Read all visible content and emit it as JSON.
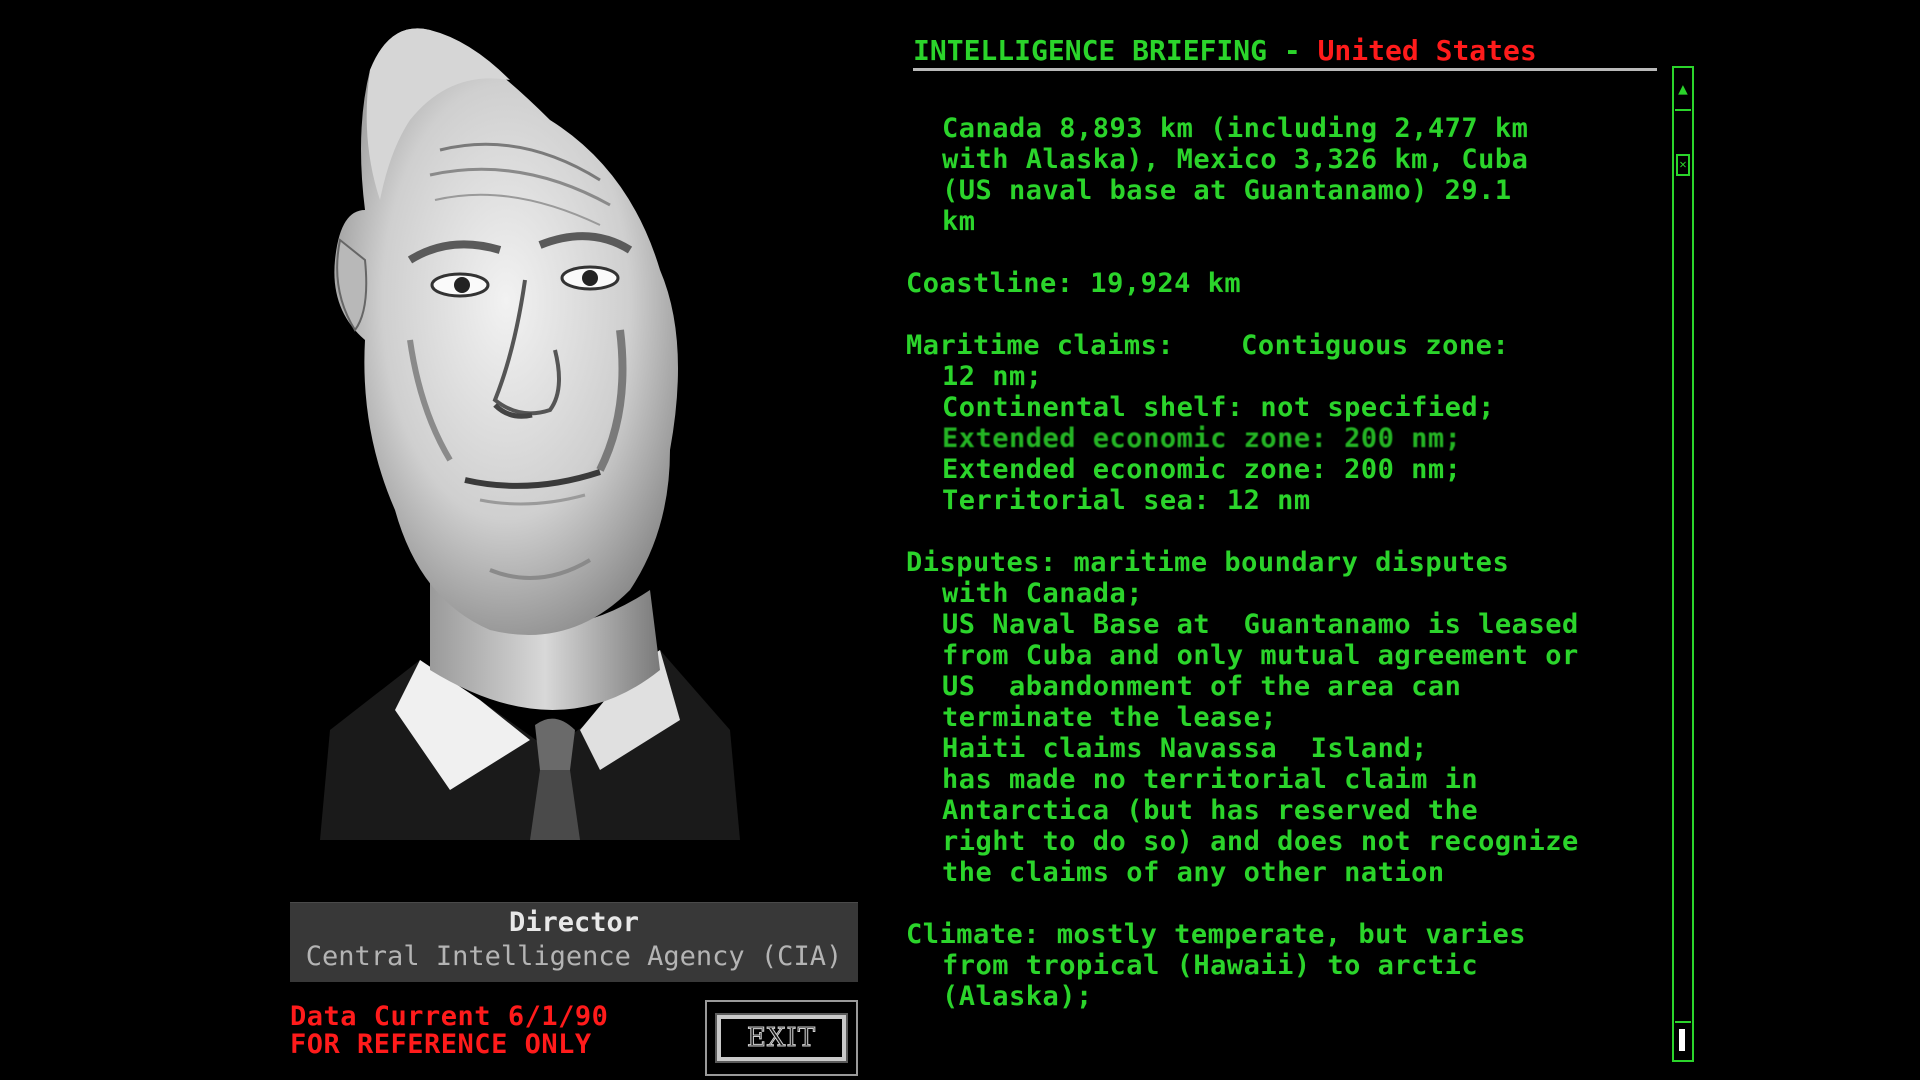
{
  "header": {
    "label": "INTELLIGENCE BRIEFING - ",
    "country": "United States"
  },
  "briefing": {
    "lines": [
      {
        "text": "Canada 8,893 km (including 2,477 km",
        "indent": true
      },
      {
        "text": "with Alaska), Mexico 3,326 km, Cuba",
        "indent": true
      },
      {
        "text": "(US naval base at Guantanamo) 29.1",
        "indent": true
      },
      {
        "text": "km",
        "indent": true
      },
      {
        "text": "",
        "indent": false
      },
      {
        "text": "Coastline: 19,924 km",
        "indent": false
      },
      {
        "text": "",
        "indent": false
      },
      {
        "text": "Maritime claims:    Contiguous zone:",
        "indent": false
      },
      {
        "text": "12 nm;",
        "indent": true
      },
      {
        "text": "Continental shelf: not specified;",
        "indent": true
      },
      {
        "text": "Extended economic zone: 200 nm;",
        "indent": true,
        "garbled": true
      },
      {
        "text": "Extended economic zone: 200 nm;",
        "indent": true
      },
      {
        "text": "Territorial sea: 12 nm",
        "indent": true
      },
      {
        "text": "",
        "indent": false
      },
      {
        "text": "Disputes: maritime boundary disputes",
        "indent": false
      },
      {
        "text": "with Canada;",
        "indent": true
      },
      {
        "text": "US Naval Base at  Guantanamo is leased",
        "indent": true
      },
      {
        "text": "from Cuba and only mutual agreement or",
        "indent": true
      },
      {
        "text": "US  abandonment of the area can",
        "indent": true
      },
      {
        "text": "terminate the lease;",
        "indent": true
      },
      {
        "text": "Haiti claims Navassa  Island;",
        "indent": true
      },
      {
        "text": "has made no territorial claim in",
        "indent": true
      },
      {
        "text": "Antarctica (but has reserved the",
        "indent": true
      },
      {
        "text": "right to do so) and does not recognize",
        "indent": true
      },
      {
        "text": "the claims of any other nation",
        "indent": true
      },
      {
        "text": "",
        "indent": false
      },
      {
        "text": "Climate: mostly temperate, but varies",
        "indent": false
      },
      {
        "text": "from tropical (Hawaii) to arctic",
        "indent": true
      },
      {
        "text": "(Alaska);",
        "indent": true
      }
    ]
  },
  "caption": {
    "title": "Director",
    "subtitle": "Central Intelligence Agency (CIA)"
  },
  "notice": {
    "line1": "Data Current 6/1/90",
    "line2": "FOR REFERENCE ONLY"
  },
  "exit_button": {
    "label": "EXIT"
  },
  "scrollbar": {
    "position": 0.03
  },
  "colors": {
    "text_green": "#2bd42b",
    "accent_red": "#ff1b1b",
    "background": "#000000",
    "caption_bg": "#383838"
  },
  "icons": {
    "portrait": "cia-director-portrait",
    "scroll_up": "scroll-up-arrow-icon",
    "scroll_thumb": "scroll-thumb-icon"
  }
}
